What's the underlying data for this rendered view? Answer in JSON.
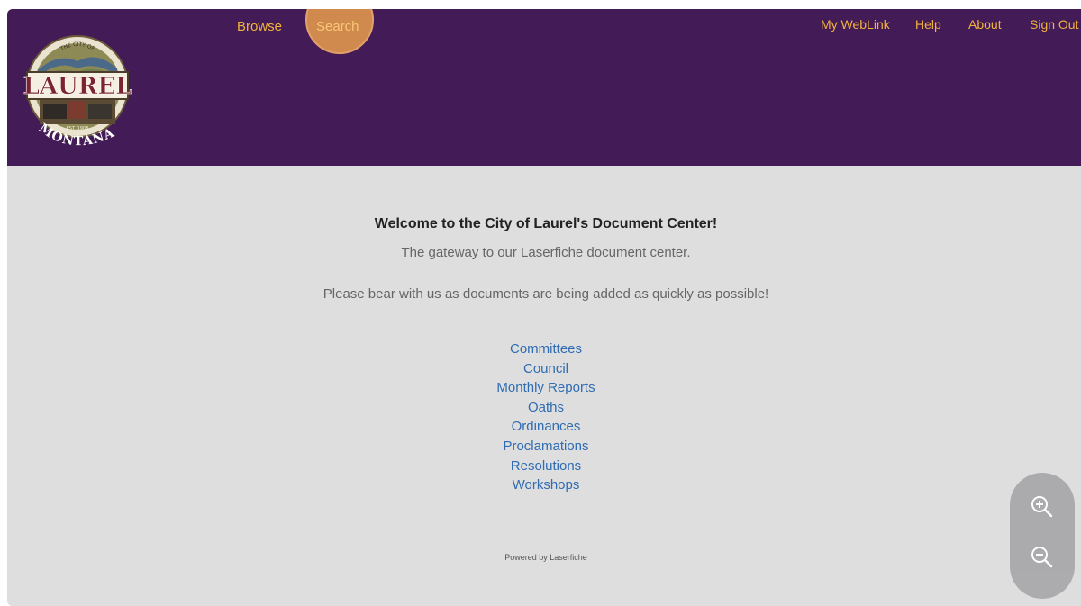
{
  "colors": {
    "header_bg": "#431b56",
    "nav_link": "#f2b33d",
    "content_bg": "#dedede",
    "folder_link": "#2f6cb3",
    "search_bubble": "#d08a4e"
  },
  "logo": {
    "icon": "city-of-laurel-seal-logo",
    "text_main": "LAUREL",
    "text_bottom": "MONTANA",
    "text_arc": "THE CITY OF",
    "text_est": "EST. 1908"
  },
  "nav": {
    "browse": "Browse",
    "search": "Search"
  },
  "utility": {
    "my_weblink": "My WebLink",
    "help": "Help",
    "about": "About",
    "sign_out": "Sign Out"
  },
  "main": {
    "welcome": "Welcome to the City of Laurel's Document Center!",
    "gateway": "The gateway to our Laserfiche document center.",
    "notice": "Please bear with us as documents are being added as quickly as possible!",
    "folders": [
      "Committees",
      "Council",
      "Monthly Reports",
      "Oaths",
      "Ordinances",
      "Proclamations",
      "Resolutions",
      "Workshops"
    ],
    "powered_by": "Powered by Laserfiche"
  },
  "zoom": {
    "in_icon": "zoom-in-icon",
    "out_icon": "zoom-out-icon"
  }
}
